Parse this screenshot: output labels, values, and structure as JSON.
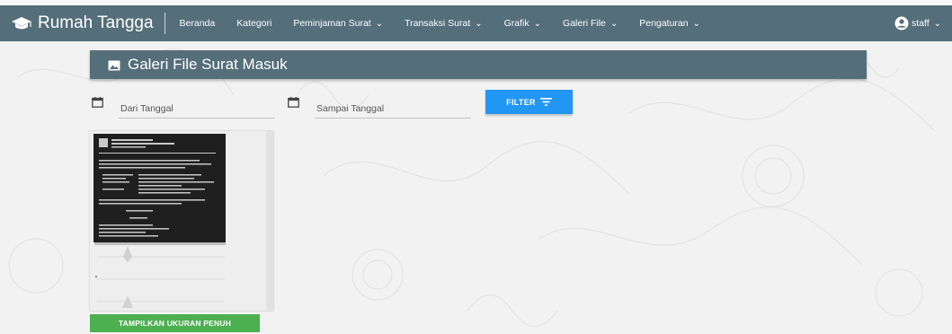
{
  "navbar": {
    "brand": "Rumah Tangga",
    "brand_icon": "graduation-cap-icon",
    "items": [
      {
        "label": "Beranda",
        "caret": ""
      },
      {
        "label": "Kategori",
        "caret": ""
      },
      {
        "label": "Peminjaman Surat",
        "caret": "⌄"
      },
      {
        "label": "Transaksi Surat",
        "caret": "⌄"
      },
      {
        "label": "Grafik",
        "caret": "⌄"
      },
      {
        "label": "Galeri File",
        "caret": "⌄"
      },
      {
        "label": "Pengaturan",
        "caret": "⌄"
      }
    ],
    "user": {
      "label": "staff",
      "caret": "⌄",
      "icon": "user-circle-icon"
    }
  },
  "page": {
    "title": "Galeri File Surat Masuk",
    "title_icon": "image-icon"
  },
  "filters": {
    "from_placeholder": "Dari Tanggal",
    "to_placeholder": "Sampai Tanggal",
    "button_label": "FILTER",
    "button_icon": "filter-lines-icon"
  },
  "gallery": {
    "fullsize_label": "TAMPILKAN UKURAN PENUH"
  },
  "colors": {
    "navbar": "#546e7a",
    "filter_button": "#2196f3",
    "fullsize_button": "#4caf50"
  }
}
